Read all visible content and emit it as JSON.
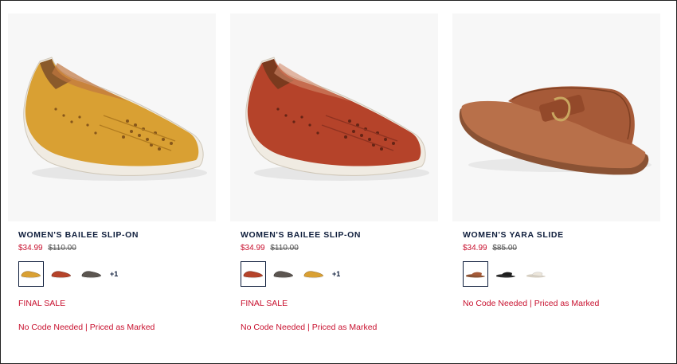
{
  "products": [
    {
      "name": "WOMEN'S BAILEE SLIP-ON",
      "sale_price": "$34.99",
      "original_price": "$110.00",
      "shoe_color": "#d9a033",
      "swatches": [
        {
          "color": "#d9a033",
          "selected": true
        },
        {
          "color": "#b5432a",
          "selected": false
        },
        {
          "color": "#5b5550",
          "selected": false
        }
      ],
      "more_colors": "+1",
      "final_sale": "FINAL SALE",
      "promo": "No Code Needed | Priced as Marked"
    },
    {
      "name": "WOMEN'S BAILEE SLIP-ON",
      "sale_price": "$34.99",
      "original_price": "$110.00",
      "shoe_color": "#b5432a",
      "swatches": [
        {
          "color": "#b5432a",
          "selected": true
        },
        {
          "color": "#5b5550",
          "selected": false
        },
        {
          "color": "#d9a033",
          "selected": false
        }
      ],
      "more_colors": "+1",
      "final_sale": "FINAL SALE",
      "promo": "No Code Needed | Priced as Marked"
    },
    {
      "name": "WOMEN'S YARA SLIDE",
      "sale_price": "$34.99",
      "original_price": "$85.00",
      "shoe_color": "#a65a38",
      "swatches": [
        {
          "color": "#a65a38",
          "selected": true
        },
        {
          "color": "#1d1d1d",
          "selected": false
        },
        {
          "color": "#ece6db",
          "selected": false
        }
      ],
      "promo": "No Code Needed | Priced as Marked"
    }
  ],
  "colors": {
    "title": "#0f1e3c",
    "sale": "#c8102e",
    "image_bg": "#f7f7f7"
  }
}
